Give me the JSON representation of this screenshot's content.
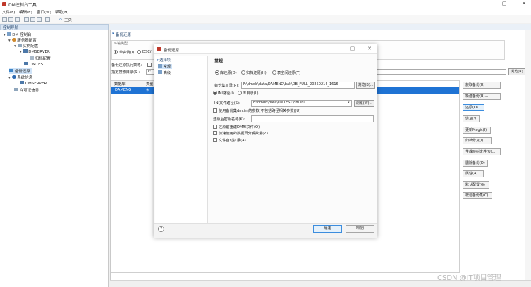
{
  "window": {
    "title": "DM控制台工具",
    "controls": [
      "—",
      "▢",
      "✕"
    ]
  },
  "menu": [
    "文件(F)",
    "编辑(E)",
    "窗口(W)",
    "帮助(H)"
  ],
  "home_tab": "主页",
  "left_panel": {
    "header": "控制导航",
    "tree": [
      {
        "label": "DM 控制台",
        "level": 0
      },
      {
        "label": "服务器配置",
        "level": 1
      },
      {
        "label": "实例配置",
        "level": 2
      },
      {
        "label": "DMSERVER",
        "level": 3
      },
      {
        "label": "归档配置",
        "level": 4
      },
      {
        "label": "DMTEST",
        "level": 3
      },
      {
        "label": "备份还原",
        "level": 1,
        "selected": true
      },
      {
        "label": "系统信息",
        "level": 1
      },
      {
        "label": "DMSERVER",
        "level": 2
      },
      {
        "label": "许可证信息",
        "level": 1
      }
    ]
  },
  "main": {
    "section": "备份还原",
    "env_label": "环境类型",
    "env_radio1": "单实例(I)",
    "env_radio2": "DSC(",
    "exec_label": "备份还原执行策略:",
    "path_label": "指定搜索目录(S):",
    "path_value": "F:",
    "browse": "浏览(R)",
    "table_header": "数据库",
    "table_header2": "类型",
    "table_row": "DAMENG",
    "table_row2": "表"
  },
  "side_buttons": [
    "获取备份(R)",
    "新建备份(B)...",
    "还原(O)...",
    "恢复(V)",
    "更新Magic(I)",
    "归档修复(I)...",
    "生成映射文件(U)...",
    "删除备份(D)",
    "属性(A)...",
    "默认配置(G)",
    "校验备份集(C)"
  ],
  "dialog": {
    "title": "备份还原",
    "nav_group": "选择项",
    "nav_items": [
      "常规",
      "高级"
    ],
    "content_title": "常规",
    "restore_type": [
      "库还原(D)",
      "归档还原(H)",
      "表空间还原(Y)"
    ],
    "backupset_label": "备份集目录(P):",
    "backupset_value": "F:\\dmdb\\data\\DAMENG\\bak\\DB_FULL_20250214_1616",
    "browse": "浏览(B)...",
    "ini_options": [
      "INI路径(I)",
      "库目录(L)"
    ],
    "ini_label": "INI文件路径(S):",
    "ini_value": "F:\\dmdb\\data\\DMTEST\\dm.ini",
    "ini_browse": "浏览(W)...",
    "use_ini_check": "使用备份集dm.ini的参数(不包括路径相关参数)(U)",
    "key_label": "还原后密钥名称(K):",
    "check_options": [
      "还原前重建DM库文件(O)",
      "加速使用的数据页分解数量(Z)",
      "文件自动扩展(A)"
    ],
    "ok": "确定",
    "cancel": "取消",
    "help": "?"
  },
  "watermark": "CSDN @IT项目管理"
}
